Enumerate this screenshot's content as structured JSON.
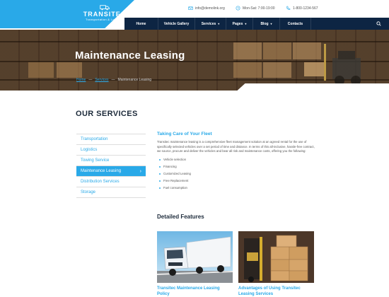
{
  "brand": {
    "title": "TRANSITEC",
    "subtitle": "Transportation & Logistics"
  },
  "topbar": {
    "email": "info@demolink.org",
    "hours": "Mon-Sat: 7:00-19:00",
    "phone": "1-800-1234-567"
  },
  "nav": {
    "items": [
      {
        "label": "Home",
        "dropdown": false
      },
      {
        "label": "Vehicle Gallery",
        "dropdown": false
      },
      {
        "label": "Services",
        "dropdown": true
      },
      {
        "label": "Pages",
        "dropdown": true
      },
      {
        "label": "Blog",
        "dropdown": true
      },
      {
        "label": "Contacts",
        "dropdown": false
      }
    ]
  },
  "hero": {
    "title": "Maintenance Leasing",
    "breadcrumb": [
      "Home",
      "Services",
      "Maintenance Leasing"
    ],
    "separator": "—"
  },
  "services": {
    "title": "OUR SERVICES",
    "items": [
      {
        "label": "Transportation",
        "active": false
      },
      {
        "label": "Logistics",
        "active": false
      },
      {
        "label": "Towing Service",
        "active": false
      },
      {
        "label": "Maintenance Leasing",
        "active": true
      },
      {
        "label": "Distribution Services",
        "active": false
      },
      {
        "label": "Storage",
        "active": false
      }
    ],
    "active_arrow": "›"
  },
  "content": {
    "heading": "Taking Care of Your Fleet",
    "paragraph": "Transitec maintenance leasing is a comprehensive fleet management solution at an agreed rental for the use of specifically selected vehicles over a set period of time and distance. In terms of this all-inclusive, hassle-free contract, we source, procure and deliver the vehicles and bear all risk and maintenance costs, offering you the following:",
    "list": [
      "Vehicle selection",
      "Financing",
      "Customized Leasing",
      "Free Replacement",
      "Fuel consumption"
    ]
  },
  "features": {
    "title": "Detailed Features",
    "cards": [
      {
        "caption": "Transitec Maintenance Leasing Policy",
        "image": "truck-photo"
      },
      {
        "caption": "Advantages of Using Transitec Leasing Services",
        "image": "forklift-boxes-photo"
      }
    ]
  },
  "colors": {
    "accent": "#29a9e8",
    "navy": "#0d2543",
    "heading": "#1c2a3a"
  }
}
